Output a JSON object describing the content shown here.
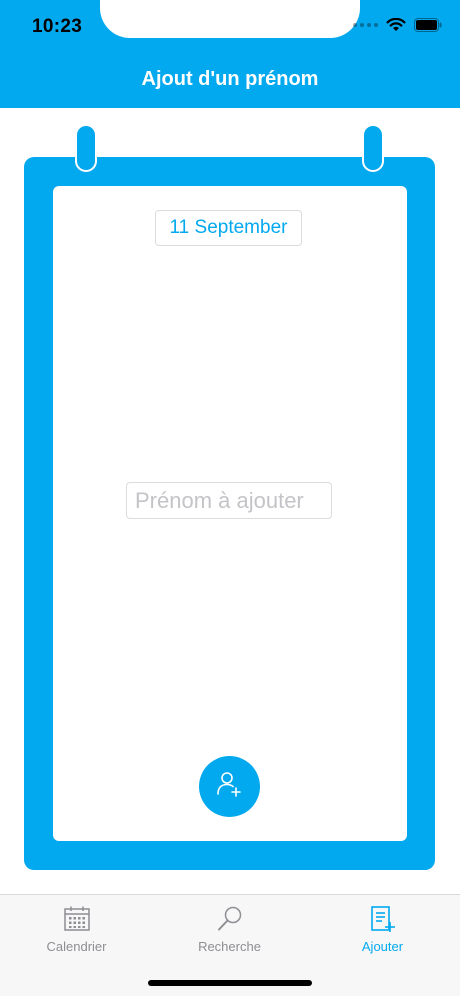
{
  "status_bar": {
    "time": "10:23"
  },
  "header": {
    "title": "Ajout d'un prénom"
  },
  "calendar_page": {
    "date_label": "11 September",
    "name_input": {
      "value": "",
      "placeholder": "Prénom à ajouter"
    },
    "add_button_icon": "add-user-icon"
  },
  "tab_bar": {
    "items": [
      {
        "label": "Calendrier",
        "icon": "calendar-icon",
        "active": false
      },
      {
        "label": "Recherche",
        "icon": "magnifier-icon",
        "active": false
      },
      {
        "label": "Ajouter",
        "icon": "add-entry-icon",
        "active": true
      }
    ]
  },
  "colors": {
    "accent": "#03A9EE",
    "inactive": "#8e8e93",
    "tabbar_bg": "#f7f7f8"
  }
}
